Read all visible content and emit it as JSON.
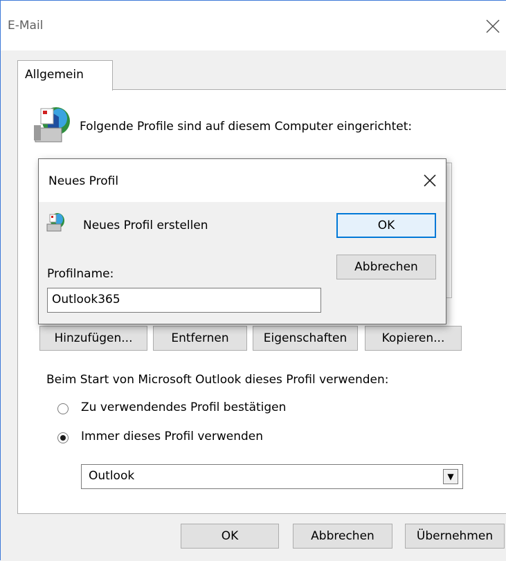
{
  "window": {
    "title": "E-Mail",
    "tab_label": "Allgemein",
    "profiles_label": "Folgende Profile sind auf diesem Computer eingerichtet:",
    "buttons": {
      "add": "Hinzufügen...",
      "remove": "Entfernen",
      "properties": "Eigenschaften",
      "copy": "Kopieren..."
    },
    "startup_label": "Beim Start von Microsoft Outlook dieses Profil verwenden:",
    "radio_options": [
      {
        "label": "Zu verwendendes Profil bestätigen",
        "selected": false
      },
      {
        "label": "Immer dieses Profil verwenden",
        "selected": true
      }
    ],
    "profile_select_value": "Outlook",
    "footer": {
      "ok": "OK",
      "cancel": "Abbrechen",
      "apply": "Übernehmen"
    }
  },
  "dialog": {
    "title": "Neues Profil",
    "heading": "Neues Profil erstellen",
    "ok": "OK",
    "cancel": "Abbrechen",
    "profile_name_label": "Profilname:",
    "profile_name_value": "Outlook365"
  },
  "colors": {
    "window_bg": "#f0f0f0",
    "focus_accent": "#0078d7",
    "window_border": "#3c78d8"
  }
}
